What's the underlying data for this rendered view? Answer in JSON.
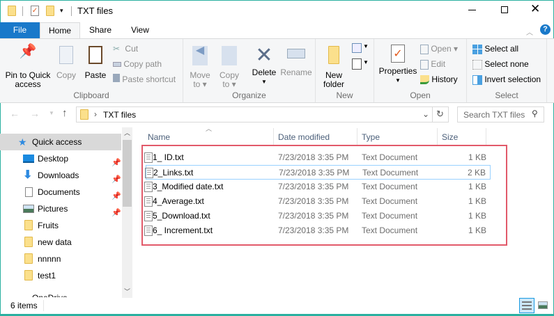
{
  "window": {
    "title": "TXT files",
    "accent": "#1979ca",
    "border": "#2ab0a0"
  },
  "tabs": [
    {
      "label": "File"
    },
    {
      "label": "Home"
    },
    {
      "label": "Share"
    },
    {
      "label": "View"
    }
  ],
  "ribbon": {
    "clipboard": {
      "label": "Clipboard",
      "pin": "Pin to Quick access",
      "pin1": "Pin to Quick",
      "pin2": "access",
      "copy": "Copy",
      "paste": "Paste",
      "cut": "Cut",
      "copy_path": "Copy path",
      "paste_shortcut": "Paste shortcut"
    },
    "organize": {
      "label": "Organize",
      "move1": "Move",
      "move2": "to",
      "copy1": "Copy",
      "copy2": "to",
      "delete": "Delete",
      "rename": "Rename"
    },
    "new": {
      "label": "New",
      "new1": "New",
      "new2": "folder"
    },
    "open": {
      "label": "Open",
      "properties": "Properties",
      "open": "Open",
      "edit": "Edit",
      "history": "History"
    },
    "select": {
      "label": "Select",
      "all": "Select all",
      "none": "Select none",
      "invert": "Invert selection"
    }
  },
  "address": {
    "path": "TXT files",
    "search_placeholder": "Search TXT files"
  },
  "nav": {
    "items": [
      {
        "label": "Quick access",
        "icon": "star-icon"
      },
      {
        "label": "Desktop",
        "icon": "desktop-icon",
        "pinned": true
      },
      {
        "label": "Downloads",
        "icon": "download-icon",
        "pinned": true
      },
      {
        "label": "Documents",
        "icon": "documents-icon",
        "pinned": true
      },
      {
        "label": "Pictures",
        "icon": "pictures-icon",
        "pinned": true
      },
      {
        "label": "Fruits",
        "icon": "folder-icon"
      },
      {
        "label": "new data",
        "icon": "folder-icon"
      },
      {
        "label": "nnnnn",
        "icon": "folder-icon"
      },
      {
        "label": "test1",
        "icon": "folder-icon"
      },
      {
        "label": "OneDrive",
        "icon": "onedrive-icon"
      }
    ]
  },
  "columns": {
    "name": "Name",
    "date": "Date modified",
    "type": "Type",
    "size": "Size"
  },
  "files": [
    {
      "name": "1_ ID.txt",
      "date": "7/23/2018 3:35 PM",
      "type": "Text Document",
      "size": "1 KB"
    },
    {
      "name": "2_Links.txt",
      "date": "7/23/2018 3:35 PM",
      "type": "Text Document",
      "size": "2 KB"
    },
    {
      "name": "3_Modified date.txt",
      "date": "7/23/2018 3:35 PM",
      "type": "Text Document",
      "size": "1 KB"
    },
    {
      "name": "4_Average.txt",
      "date": "7/23/2018 3:35 PM",
      "type": "Text Document",
      "size": "1 KB"
    },
    {
      "name": "5_Download.txt",
      "date": "7/23/2018 3:35 PM",
      "type": "Text Document",
      "size": "1 KB"
    },
    {
      "name": "6_ Increment.txt",
      "date": "7/23/2018 3:35 PM",
      "type": "Text Document",
      "size": "1 KB"
    }
  ],
  "status": {
    "count": "6 items"
  }
}
